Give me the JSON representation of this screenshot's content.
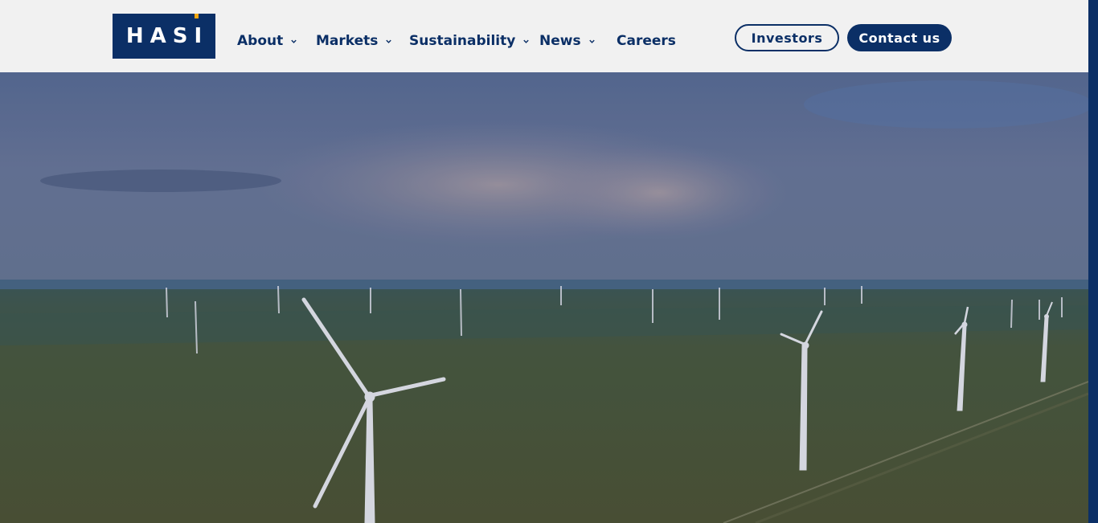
{
  "brand": {
    "logo_text": "HASI",
    "navy": "#0b2f66",
    "accent": "#f3a712"
  },
  "nav": {
    "items": [
      {
        "label": "About",
        "has_dropdown": true
      },
      {
        "label": "Markets",
        "has_dropdown": true
      },
      {
        "label": "Sustainability",
        "has_dropdown": true
      },
      {
        "label": "News",
        "has_dropdown": true
      },
      {
        "label": "Careers",
        "has_dropdown": false
      }
    ]
  },
  "actions": {
    "investors_label": "Investors",
    "contact_label": "Contact us"
  },
  "hero": {
    "image": "wind-farm-photo"
  }
}
